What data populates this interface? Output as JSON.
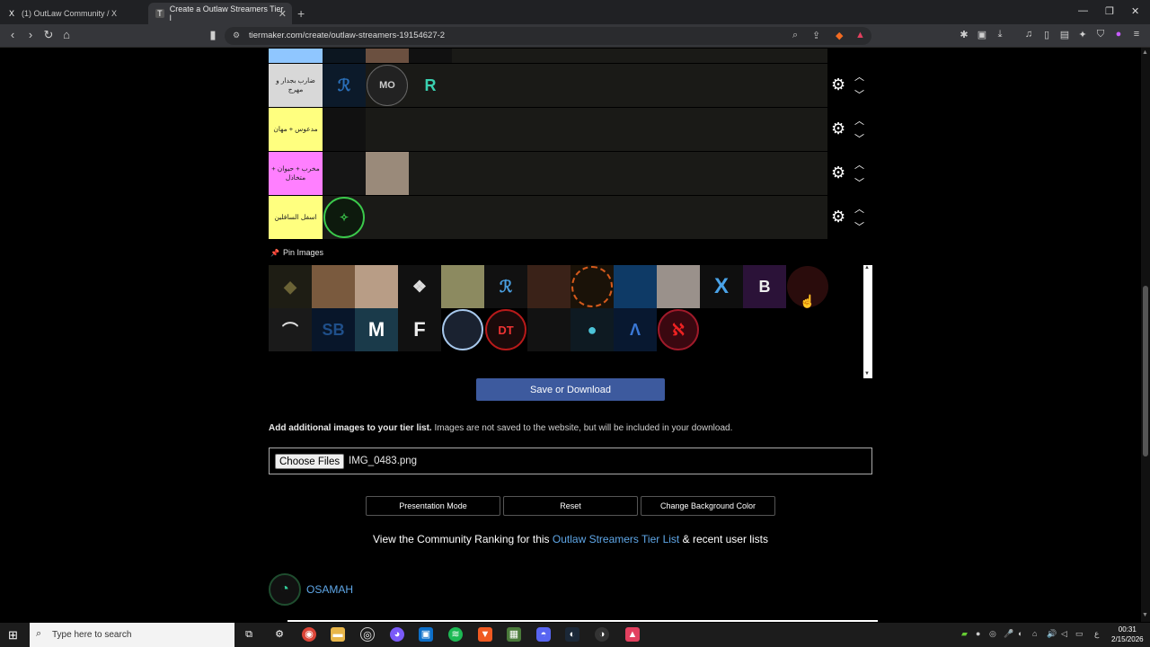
{
  "browser": {
    "tabs": [
      {
        "icon": "X",
        "title": "(1) OutLaw Community / X",
        "active": false
      },
      {
        "icon": "T",
        "title": "Create a Outlaw Streamers Tier l",
        "active": true
      }
    ],
    "new_tab": "+",
    "url": "tiermaker.com/create/outlaw-streamers-19154627-2"
  },
  "tiers": [
    {
      "label": "",
      "color": "#8fc6ff"
    },
    {
      "label": "ضارب بجدار و مهرج",
      "color": "#d8d8d8"
    },
    {
      "label": "مدعوس + مهان",
      "color": "#ffff7f"
    },
    {
      "label": "مخرب + حيوان + متخاذل",
      "color": "#ff7fff"
    },
    {
      "label": "اسفل السافلين",
      "color": "#ffff7f"
    }
  ],
  "pin_images": {
    "label": "Pin Images"
  },
  "save_button": "Save or Download",
  "additional": {
    "bold": "Add additional images to your tier list.",
    "rest": "Images are not saved to the website, but will be included in your download."
  },
  "file_input": {
    "button": "Choose Files",
    "filename": "IMG_0483.png"
  },
  "buttons": {
    "presentation": "Presentation Mode",
    "reset": "Reset",
    "bg_color": "Change Background Color"
  },
  "community": {
    "prefix": "View the Community Ranking for this",
    "link": "Outlaw Streamers Tier List",
    "suffix": "& recent user lists"
  },
  "user": {
    "name": "OSAMAH"
  },
  "taskbar": {
    "search_placeholder": "Type here to search",
    "time": "00:31",
    "date": "2/15/2026",
    "lang": "ع"
  }
}
